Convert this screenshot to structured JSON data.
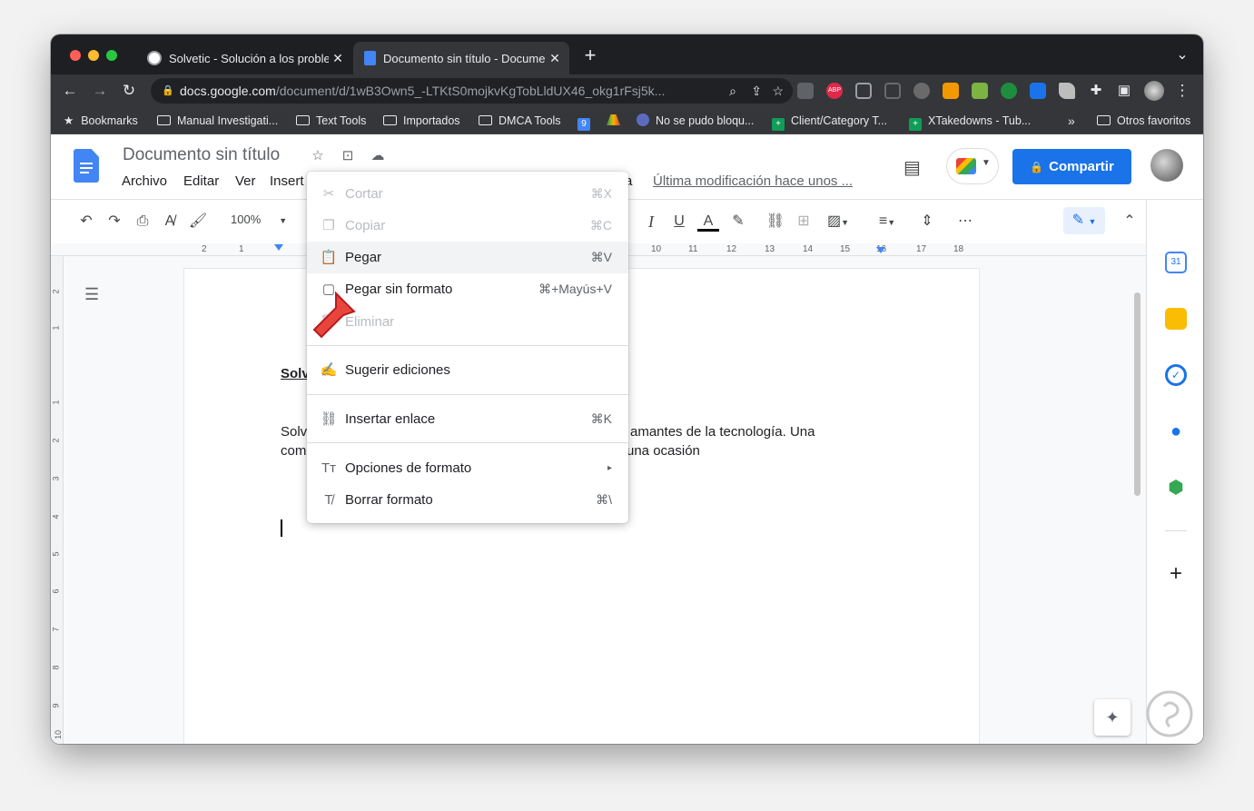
{
  "browser": {
    "tabs": [
      {
        "title": "Solvetic - Solución a los proble",
        "close": "✕"
      },
      {
        "title": "Documento sin título - Docume",
        "close": "✕"
      }
    ],
    "new_tab": "+",
    "tab_menu": "⌄",
    "address": {
      "domain": "docs.google.com",
      "path": "/document/d/1wB3Own5_-LTKtS0mojkvKgTobLldUX46_okg1rFsj5k..."
    },
    "bookmarks": [
      {
        "label": "Bookmarks",
        "icon": "star-icon"
      },
      {
        "label": "Manual Investigati...",
        "icon": "folder-icon"
      },
      {
        "label": "Text Tools",
        "icon": "folder-icon"
      },
      {
        "label": "Importados",
        "icon": "folder-icon"
      },
      {
        "label": "DMCA Tools",
        "icon": "folder-icon"
      },
      {
        "label": "No se pudo bloqu...",
        "icon": "site-icon"
      },
      {
        "label": "Client/Category T...",
        "icon": "sheets-icon"
      },
      {
        "label": "XTakedowns - Tub...",
        "icon": "sheets-icon"
      },
      {
        "label": "»",
        "icon": "overflow"
      },
      {
        "label": "Otros favoritos",
        "icon": "folder-icon"
      }
    ]
  },
  "docs": {
    "title": "Documento sin título",
    "menus": [
      "Archivo",
      "Editar",
      "Ver",
      "Insert",
      "a"
    ],
    "last_modified": "Última modificación hace unos ...",
    "share_label": "Compartir",
    "zoom": "100%",
    "ruler_numbers": [
      "2",
      "1",
      "10",
      "11",
      "12",
      "13",
      "14",
      "15",
      "16",
      "17",
      "18"
    ],
    "vruler_numbers": [
      "2",
      "1",
      "1",
      "2",
      "3",
      "4",
      "5",
      "6",
      "7",
      "8",
      "9",
      "10"
    ],
    "body": {
      "line_heading": "Solv",
      "line1_start": "Solv",
      "line1_end": "amantes de la tecnología. Una",
      "line2_start": "com",
      "line2_end": "una ocasión"
    }
  },
  "context_menu": {
    "items": [
      {
        "label": "Cortar",
        "shortcut": "⌘X",
        "icon": "scissors-icon",
        "disabled": true
      },
      {
        "label": "Copiar",
        "shortcut": "⌘C",
        "icon": "copy-icon",
        "disabled": true
      },
      {
        "label": "Pegar",
        "shortcut": "⌘V",
        "icon": "clipboard-icon",
        "disabled": false
      },
      {
        "label": "Pegar sin formato",
        "shortcut": "⌘+Mayús+V",
        "icon": "paste-plain-icon",
        "disabled": false
      },
      {
        "label": "Eliminar",
        "shortcut": "",
        "icon": "trash-icon",
        "disabled": true
      },
      {
        "label": "Sugerir ediciones",
        "shortcut": "",
        "icon": "suggest-icon",
        "disabled": false
      },
      {
        "label": "Insertar enlace",
        "shortcut": "⌘K",
        "icon": "link-icon",
        "disabled": false
      },
      {
        "label": "Opciones de formato",
        "shortcut": "▸",
        "icon": "text-format-icon",
        "disabled": false
      },
      {
        "label": "Borrar formato",
        "shortcut": "⌘\\",
        "icon": "clear-format-icon",
        "disabled": false
      }
    ]
  },
  "colors": {
    "accent": "#1a73e8",
    "arrow": "#e8453c"
  }
}
